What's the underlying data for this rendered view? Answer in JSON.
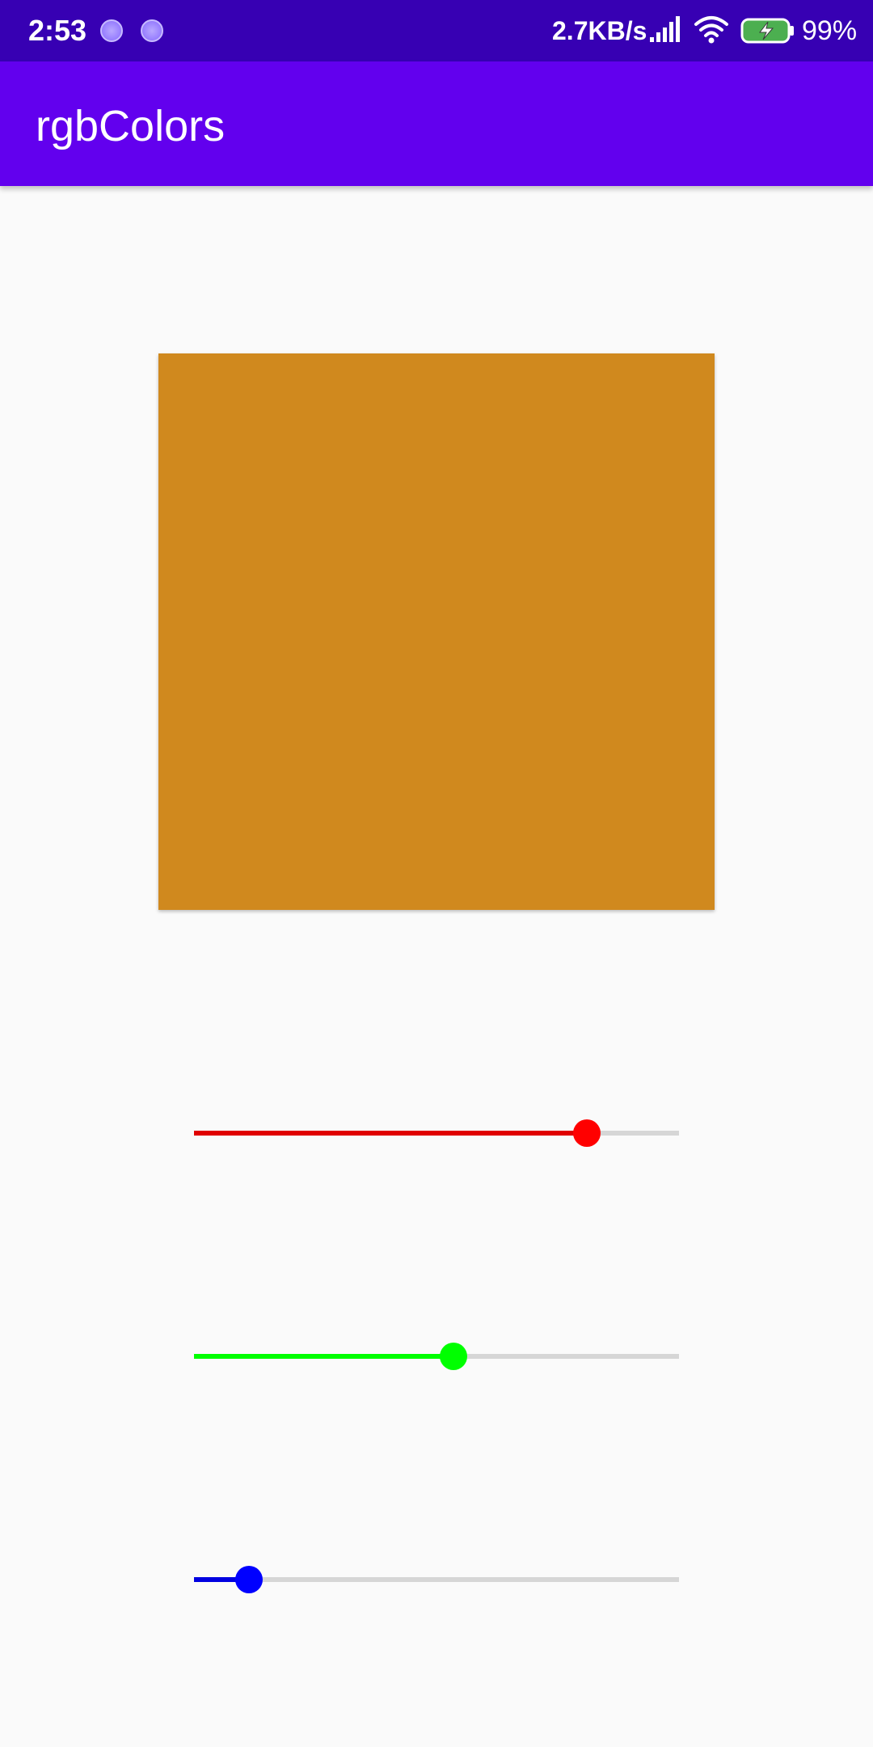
{
  "status_bar": {
    "time": "2:53",
    "net_speed": "2.7KB/s",
    "battery_percent": "99%",
    "icons": [
      "notification-icon",
      "notification-icon",
      "signal-icon",
      "wifi-icon",
      "battery-charging-icon"
    ]
  },
  "app_bar": {
    "title": "rgbColors",
    "color": "#6200ee"
  },
  "preview": {
    "color": "#d0891e"
  },
  "sliders": [
    {
      "name": "red",
      "color": "#ff0000",
      "fill_color": "#e00000",
      "value": 0.81
    },
    {
      "name": "green",
      "color": "#00ff00",
      "fill_color": "#00ff00",
      "value": 0.535
    },
    {
      "name": "blue",
      "color": "#0000ff",
      "fill_color": "#0000e0",
      "value": 0.113
    }
  ]
}
